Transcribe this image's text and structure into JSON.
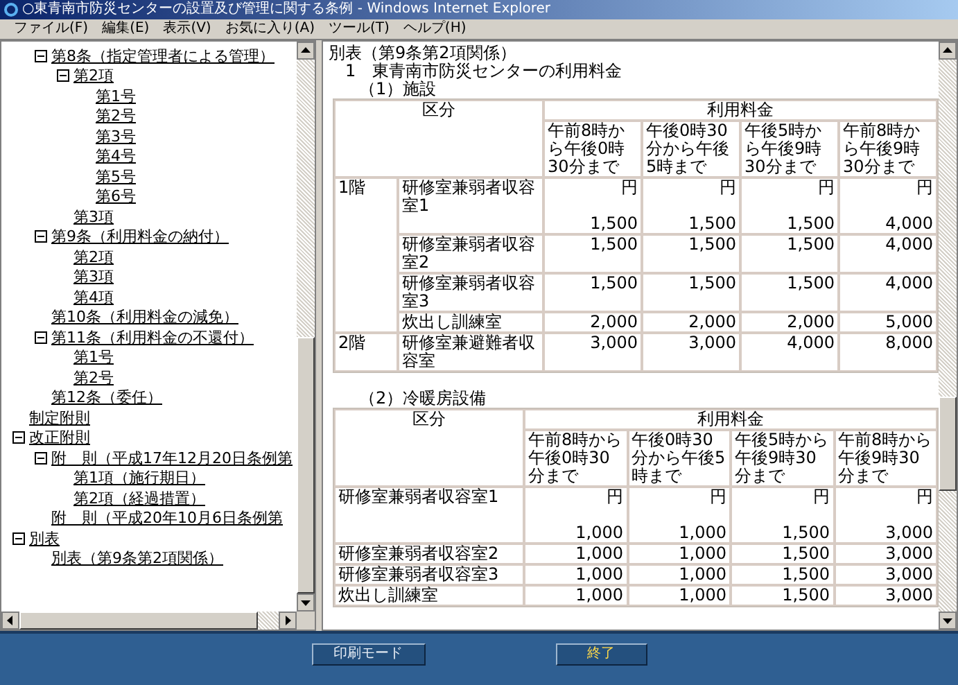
{
  "window": {
    "title": "○東青南市防災センターの設置及び管理に関する条例 - Windows Internet Explorer"
  },
  "menu": [
    "ファイル(F)",
    "編集(E)",
    "表示(V)",
    "お気に入り(A)",
    "ツール(T)",
    "ヘルプ(H)"
  ],
  "tree": [
    {
      "children": [
        {
          "label": "第8条（指定管理者による管理）",
          "expanded": true,
          "children": [
            {
              "label": "第2項",
              "expanded": true,
              "children": [
                {
                  "label": "第1号"
                },
                {
                  "label": "第2号"
                },
                {
                  "label": "第3号"
                },
                {
                  "label": "第4号"
                },
                {
                  "label": "第5号"
                },
                {
                  "label": "第6号"
                }
              ]
            },
            {
              "label": "第3項"
            }
          ]
        },
        {
          "label": "第9条（利用料金の納付）",
          "expanded": true,
          "children": [
            {
              "label": "第2項"
            },
            {
              "label": "第3項"
            },
            {
              "label": "第4項"
            }
          ]
        },
        {
          "label": "第10条（利用料金の減免）"
        },
        {
          "label": "第11条（利用料金の不還付）",
          "expanded": true,
          "children": [
            {
              "label": "第1号"
            },
            {
              "label": "第2号"
            }
          ]
        },
        {
          "label": "第12条（委任）"
        }
      ]
    },
    {
      "label": "制定附則"
    },
    {
      "label": "改正附則",
      "expanded": true,
      "children": [
        {
          "label": "附　則（平成17年12月20日条例第",
          "expanded": true,
          "children": [
            {
              "label": "第1項（施行期日）"
            },
            {
              "label": "第2項（経過措置）"
            }
          ]
        },
        {
          "label": "附　則（平成20年10月6日条例第"
        }
      ]
    },
    {
      "label": "別表",
      "expanded": true,
      "children": [
        {
          "label": "別表（第9条第2項関係）"
        }
      ]
    }
  ],
  "document": {
    "title": "別表（第9条第2項関係）",
    "heading": "1　東青南市防災センターの利用料金",
    "facilities": {
      "caption": "（1）施設",
      "category_header": "区分",
      "fee_header": "利用料金",
      "periods": [
        "午前8時から午後0時30分まで",
        "午後0時30分から午後5時まで",
        "午後5時から午後9時30分まで",
        "午前8時から午後9時30分まで"
      ],
      "groups": [
        {
          "floor": "1階",
          "rooms": [
            {
              "name": "研修室兼弱者収容室1",
              "cells": [
                {
                  "unit": "円",
                  "amount": "1,500"
                },
                {
                  "unit": "円",
                  "amount": "1,500"
                },
                {
                  "unit": "円",
                  "amount": "1,500"
                },
                {
                  "unit": "円",
                  "amount": "4,000"
                }
              ]
            },
            {
              "name": "研修室兼弱者収容室2",
              "cells": [
                {
                  "amount": "1,500"
                },
                {
                  "amount": "1,500"
                },
                {
                  "amount": "1,500"
                },
                {
                  "amount": "4,000"
                }
              ]
            },
            {
              "name": "研修室兼弱者収容室3",
              "cells": [
                {
                  "amount": "1,500"
                },
                {
                  "amount": "1,500"
                },
                {
                  "amount": "1,500"
                },
                {
                  "amount": "4,000"
                }
              ]
            },
            {
              "name": "炊出し訓練室",
              "cells": [
                {
                  "amount": "2,000"
                },
                {
                  "amount": "2,000"
                },
                {
                  "amount": "2,000"
                },
                {
                  "amount": "5,000"
                }
              ]
            }
          ]
        },
        {
          "floor": "2階",
          "rooms": [
            {
              "name": "研修室兼避難者収容室",
              "cells": [
                {
                  "amount": "3,000"
                },
                {
                  "amount": "3,000"
                },
                {
                  "amount": "4,000"
                },
                {
                  "amount": "8,000"
                }
              ]
            }
          ]
        }
      ]
    },
    "hvac": {
      "caption": "（2）冷暖房設備",
      "category_header": "区分",
      "fee_header": "利用料金",
      "periods": [
        "午前8時から午後0時30分まで",
        "午後0時30分から午後5時まで",
        "午後5時から午後9時30分まで",
        "午前8時から午後9時30分まで"
      ],
      "rows": [
        {
          "name": "研修室兼弱者収容室1",
          "cells": [
            {
              "unit": "円",
              "amount": "1,000"
            },
            {
              "unit": "円",
              "amount": "1,000"
            },
            {
              "unit": "円",
              "amount": "1,500"
            },
            {
              "unit": "円",
              "amount": "3,000"
            }
          ]
        },
        {
          "name": "研修室兼弱者収容室2",
          "cells": [
            {
              "amount": "1,000"
            },
            {
              "amount": "1,000"
            },
            {
              "amount": "1,500"
            },
            {
              "amount": "3,000"
            }
          ]
        },
        {
          "name": "研修室兼弱者収容室3",
          "cells": [
            {
              "amount": "1,000"
            },
            {
              "amount": "1,000"
            },
            {
              "amount": "1,500"
            },
            {
              "amount": "3,000"
            }
          ]
        },
        {
          "name": "炊出し訓練室",
          "cells": [
            {
              "amount": "1,000"
            },
            {
              "amount": "1,000"
            },
            {
              "amount": "1,500"
            },
            {
              "amount": "3,000"
            }
          ]
        }
      ]
    }
  },
  "footer": {
    "buttons": [
      {
        "label": "印刷モード",
        "kind": "normal"
      },
      {
        "label": "終了",
        "kind": "exit"
      }
    ]
  }
}
